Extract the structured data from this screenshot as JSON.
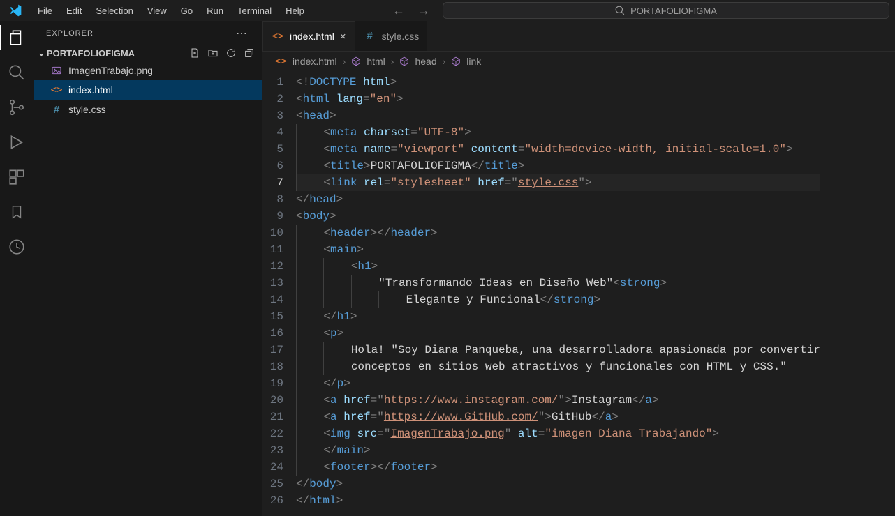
{
  "menubar": {
    "items": [
      "File",
      "Edit",
      "Selection",
      "View",
      "Go",
      "Run",
      "Terminal",
      "Help"
    ],
    "command_center": "PORTAFOLIOFIGMA"
  },
  "sidebar": {
    "title": "EXPLORER",
    "folder": "PORTAFOLIOFIGMA",
    "files": [
      {
        "icon": "image-icon",
        "label": "ImagenTrabajo.png",
        "selected": false
      },
      {
        "icon": "html-icon",
        "label": "index.html",
        "selected": true
      },
      {
        "icon": "css-icon",
        "label": "style.css",
        "selected": false
      }
    ]
  },
  "tabs": [
    {
      "icon": "html-icon",
      "label": "index.html",
      "active": true,
      "close": true
    },
    {
      "icon": "css-icon",
      "label": "style.css",
      "active": false,
      "close": false
    }
  ],
  "breadcrumbs": {
    "parts": [
      {
        "icon": "html-file",
        "label": "index.html"
      },
      {
        "icon": "cube",
        "label": "html"
      },
      {
        "icon": "cube",
        "label": "head"
      },
      {
        "icon": "cube",
        "label": "link"
      }
    ]
  },
  "code": {
    "highlight_line": 7,
    "lines": [
      [
        {
          "c": "t-punc",
          "t": "<!"
        },
        {
          "c": "t-doct",
          "t": "DOCTYPE"
        },
        {
          "c": "t-text",
          "t": " "
        },
        {
          "c": "t-attr",
          "t": "html"
        },
        {
          "c": "t-punc",
          "t": ">"
        }
      ],
      [
        {
          "c": "t-punc",
          "t": "<"
        },
        {
          "c": "t-tag",
          "t": "html"
        },
        {
          "c": "t-text",
          "t": " "
        },
        {
          "c": "t-attr",
          "t": "lang"
        },
        {
          "c": "t-punc",
          "t": "="
        },
        {
          "c": "t-str",
          "t": "\"en\""
        },
        {
          "c": "t-punc",
          "t": ">"
        }
      ],
      [
        {
          "c": "t-punc",
          "t": "<"
        },
        {
          "c": "t-tag",
          "t": "head"
        },
        {
          "c": "t-punc",
          "t": ">"
        }
      ],
      [
        {
          "indent": 1
        },
        {
          "c": "t-punc",
          "t": "<"
        },
        {
          "c": "t-tag",
          "t": "meta"
        },
        {
          "c": "t-text",
          "t": " "
        },
        {
          "c": "t-attr",
          "t": "charset"
        },
        {
          "c": "t-punc",
          "t": "="
        },
        {
          "c": "t-str",
          "t": "\"UTF-8\""
        },
        {
          "c": "t-punc",
          "t": ">"
        }
      ],
      [
        {
          "indent": 1
        },
        {
          "c": "t-punc",
          "t": "<"
        },
        {
          "c": "t-tag",
          "t": "meta"
        },
        {
          "c": "t-text",
          "t": " "
        },
        {
          "c": "t-attr",
          "t": "name"
        },
        {
          "c": "t-punc",
          "t": "="
        },
        {
          "c": "t-str",
          "t": "\"viewport\""
        },
        {
          "c": "t-text",
          "t": " "
        },
        {
          "c": "t-attr",
          "t": "content"
        },
        {
          "c": "t-punc",
          "t": "="
        },
        {
          "c": "t-str",
          "t": "\"width=device-width, initial-scale=1.0\""
        },
        {
          "c": "t-punc",
          "t": ">"
        }
      ],
      [
        {
          "indent": 1
        },
        {
          "c": "t-punc",
          "t": "<"
        },
        {
          "c": "t-tag",
          "t": "title"
        },
        {
          "c": "t-punc",
          "t": ">"
        },
        {
          "c": "t-text",
          "t": "PORTAFOLIOFIGMA"
        },
        {
          "c": "t-punc",
          "t": "</"
        },
        {
          "c": "t-tag",
          "t": "title"
        },
        {
          "c": "t-punc",
          "t": ">"
        }
      ],
      [
        {
          "indent": 1
        },
        {
          "c": "t-punc",
          "t": "<"
        },
        {
          "c": "t-tag",
          "t": "link"
        },
        {
          "c": "t-text",
          "t": " "
        },
        {
          "c": "t-attr",
          "t": "rel"
        },
        {
          "c": "t-punc",
          "t": "="
        },
        {
          "c": "t-str",
          "t": "\"stylesheet\""
        },
        {
          "c": "t-text",
          "t": " "
        },
        {
          "c": "t-attr",
          "t": "href"
        },
        {
          "c": "t-punc",
          "t": "="
        },
        {
          "c": "t-punc",
          "t": "\""
        },
        {
          "c": "t-link",
          "t": "style.css"
        },
        {
          "c": "t-punc",
          "t": "\""
        },
        {
          "c": "t-punc",
          "t": ">"
        }
      ],
      [
        {
          "c": "t-punc",
          "t": "</"
        },
        {
          "c": "t-tag",
          "t": "head"
        },
        {
          "c": "t-punc",
          "t": ">"
        }
      ],
      [
        {
          "c": "t-punc",
          "t": "<"
        },
        {
          "c": "t-tag",
          "t": "body"
        },
        {
          "c": "t-punc",
          "t": ">"
        }
      ],
      [
        {
          "indent": 1
        },
        {
          "c": "t-punc",
          "t": "<"
        },
        {
          "c": "t-tag",
          "t": "header"
        },
        {
          "c": "t-punc",
          "t": "></"
        },
        {
          "c": "t-tag",
          "t": "header"
        },
        {
          "c": "t-punc",
          "t": ">"
        }
      ],
      [
        {
          "indent": 1
        },
        {
          "c": "t-punc",
          "t": "<"
        },
        {
          "c": "t-tag",
          "t": "main"
        },
        {
          "c": "t-punc",
          "t": ">"
        }
      ],
      [
        {
          "indent": 2
        },
        {
          "c": "t-punc",
          "t": "<"
        },
        {
          "c": "t-tag",
          "t": "h1"
        },
        {
          "c": "t-punc",
          "t": ">"
        }
      ],
      [
        {
          "indent": 3
        },
        {
          "c": "t-text",
          "t": "\"Transformando Ideas en Diseño Web\""
        },
        {
          "c": "t-punc",
          "t": "<"
        },
        {
          "c": "t-tag",
          "t": "strong"
        },
        {
          "c": "t-punc",
          "t": ">"
        }
      ],
      [
        {
          "indent": 4
        },
        {
          "c": "t-text",
          "t": "Elegante y Funcional"
        },
        {
          "c": "t-punc",
          "t": "</"
        },
        {
          "c": "t-tag",
          "t": "strong"
        },
        {
          "c": "t-punc",
          "t": ">"
        }
      ],
      [
        {
          "indent": 1
        },
        {
          "c": "t-punc",
          "t": "</"
        },
        {
          "c": "t-tag",
          "t": "h1"
        },
        {
          "c": "t-punc",
          "t": ">"
        }
      ],
      [
        {
          "indent": 1
        },
        {
          "c": "t-punc",
          "t": "<"
        },
        {
          "c": "t-tag",
          "t": "p"
        },
        {
          "c": "t-punc",
          "t": ">"
        }
      ],
      [
        {
          "indent": 2
        },
        {
          "c": "t-text",
          "t": "Hola! \"Soy Diana Panqueba, una desarrolladora apasionada por convertir"
        }
      ],
      [
        {
          "indent": 2
        },
        {
          "c": "t-text",
          "t": "conceptos en sitios web atractivos y funcionales con HTML y CSS.\""
        }
      ],
      [
        {
          "indent": 1
        },
        {
          "c": "t-punc",
          "t": "</"
        },
        {
          "c": "t-tag",
          "t": "p"
        },
        {
          "c": "t-punc",
          "t": ">"
        }
      ],
      [
        {
          "indent": 1
        },
        {
          "c": "t-punc",
          "t": "<"
        },
        {
          "c": "t-tag",
          "t": "a"
        },
        {
          "c": "t-text",
          "t": " "
        },
        {
          "c": "t-attr",
          "t": "href"
        },
        {
          "c": "t-punc",
          "t": "="
        },
        {
          "c": "t-punc",
          "t": "\""
        },
        {
          "c": "t-link",
          "t": "https://www.instagram.com/"
        },
        {
          "c": "t-punc",
          "t": "\""
        },
        {
          "c": "t-punc",
          "t": ">"
        },
        {
          "c": "t-text",
          "t": "Instagram"
        },
        {
          "c": "t-punc",
          "t": "</"
        },
        {
          "c": "t-tag",
          "t": "a"
        },
        {
          "c": "t-punc",
          "t": ">"
        }
      ],
      [
        {
          "indent": 1
        },
        {
          "c": "t-punc",
          "t": "<"
        },
        {
          "c": "t-tag",
          "t": "a"
        },
        {
          "c": "t-text",
          "t": " "
        },
        {
          "c": "t-attr",
          "t": "href"
        },
        {
          "c": "t-punc",
          "t": "="
        },
        {
          "c": "t-punc",
          "t": "\""
        },
        {
          "c": "t-link",
          "t": "https://www.GitHub.com/"
        },
        {
          "c": "t-punc",
          "t": "\""
        },
        {
          "c": "t-punc",
          "t": ">"
        },
        {
          "c": "t-text",
          "t": "GitHub"
        },
        {
          "c": "t-punc",
          "t": "</"
        },
        {
          "c": "t-tag",
          "t": "a"
        },
        {
          "c": "t-punc",
          "t": ">"
        }
      ],
      [
        {
          "indent": 1
        },
        {
          "c": "t-punc",
          "t": "<"
        },
        {
          "c": "t-tag",
          "t": "img"
        },
        {
          "c": "t-text",
          "t": " "
        },
        {
          "c": "t-attr",
          "t": "src"
        },
        {
          "c": "t-punc",
          "t": "="
        },
        {
          "c": "t-punc",
          "t": "\""
        },
        {
          "c": "t-link",
          "t": "ImagenTrabajo.png"
        },
        {
          "c": "t-punc",
          "t": "\""
        },
        {
          "c": "t-text",
          "t": " "
        },
        {
          "c": "t-attr",
          "t": "alt"
        },
        {
          "c": "t-punc",
          "t": "="
        },
        {
          "c": "t-str",
          "t": "\"imagen Diana Trabajando\""
        },
        {
          "c": "t-punc",
          "t": ">"
        }
      ],
      [
        {
          "indent": 1
        },
        {
          "c": "t-punc",
          "t": "</"
        },
        {
          "c": "t-tag",
          "t": "main"
        },
        {
          "c": "t-punc",
          "t": ">"
        }
      ],
      [
        {
          "indent": 1
        },
        {
          "c": "t-punc",
          "t": "<"
        },
        {
          "c": "t-tag",
          "t": "footer"
        },
        {
          "c": "t-punc",
          "t": "></"
        },
        {
          "c": "t-tag",
          "t": "footer"
        },
        {
          "c": "t-punc",
          "t": ">"
        }
      ],
      [
        {
          "c": "t-punc",
          "t": "</"
        },
        {
          "c": "t-tag",
          "t": "body"
        },
        {
          "c": "t-punc",
          "t": ">"
        }
      ],
      [
        {
          "c": "t-punc",
          "t": "</"
        },
        {
          "c": "t-tag",
          "t": "html"
        },
        {
          "c": "t-punc",
          "t": ">"
        }
      ]
    ]
  }
}
